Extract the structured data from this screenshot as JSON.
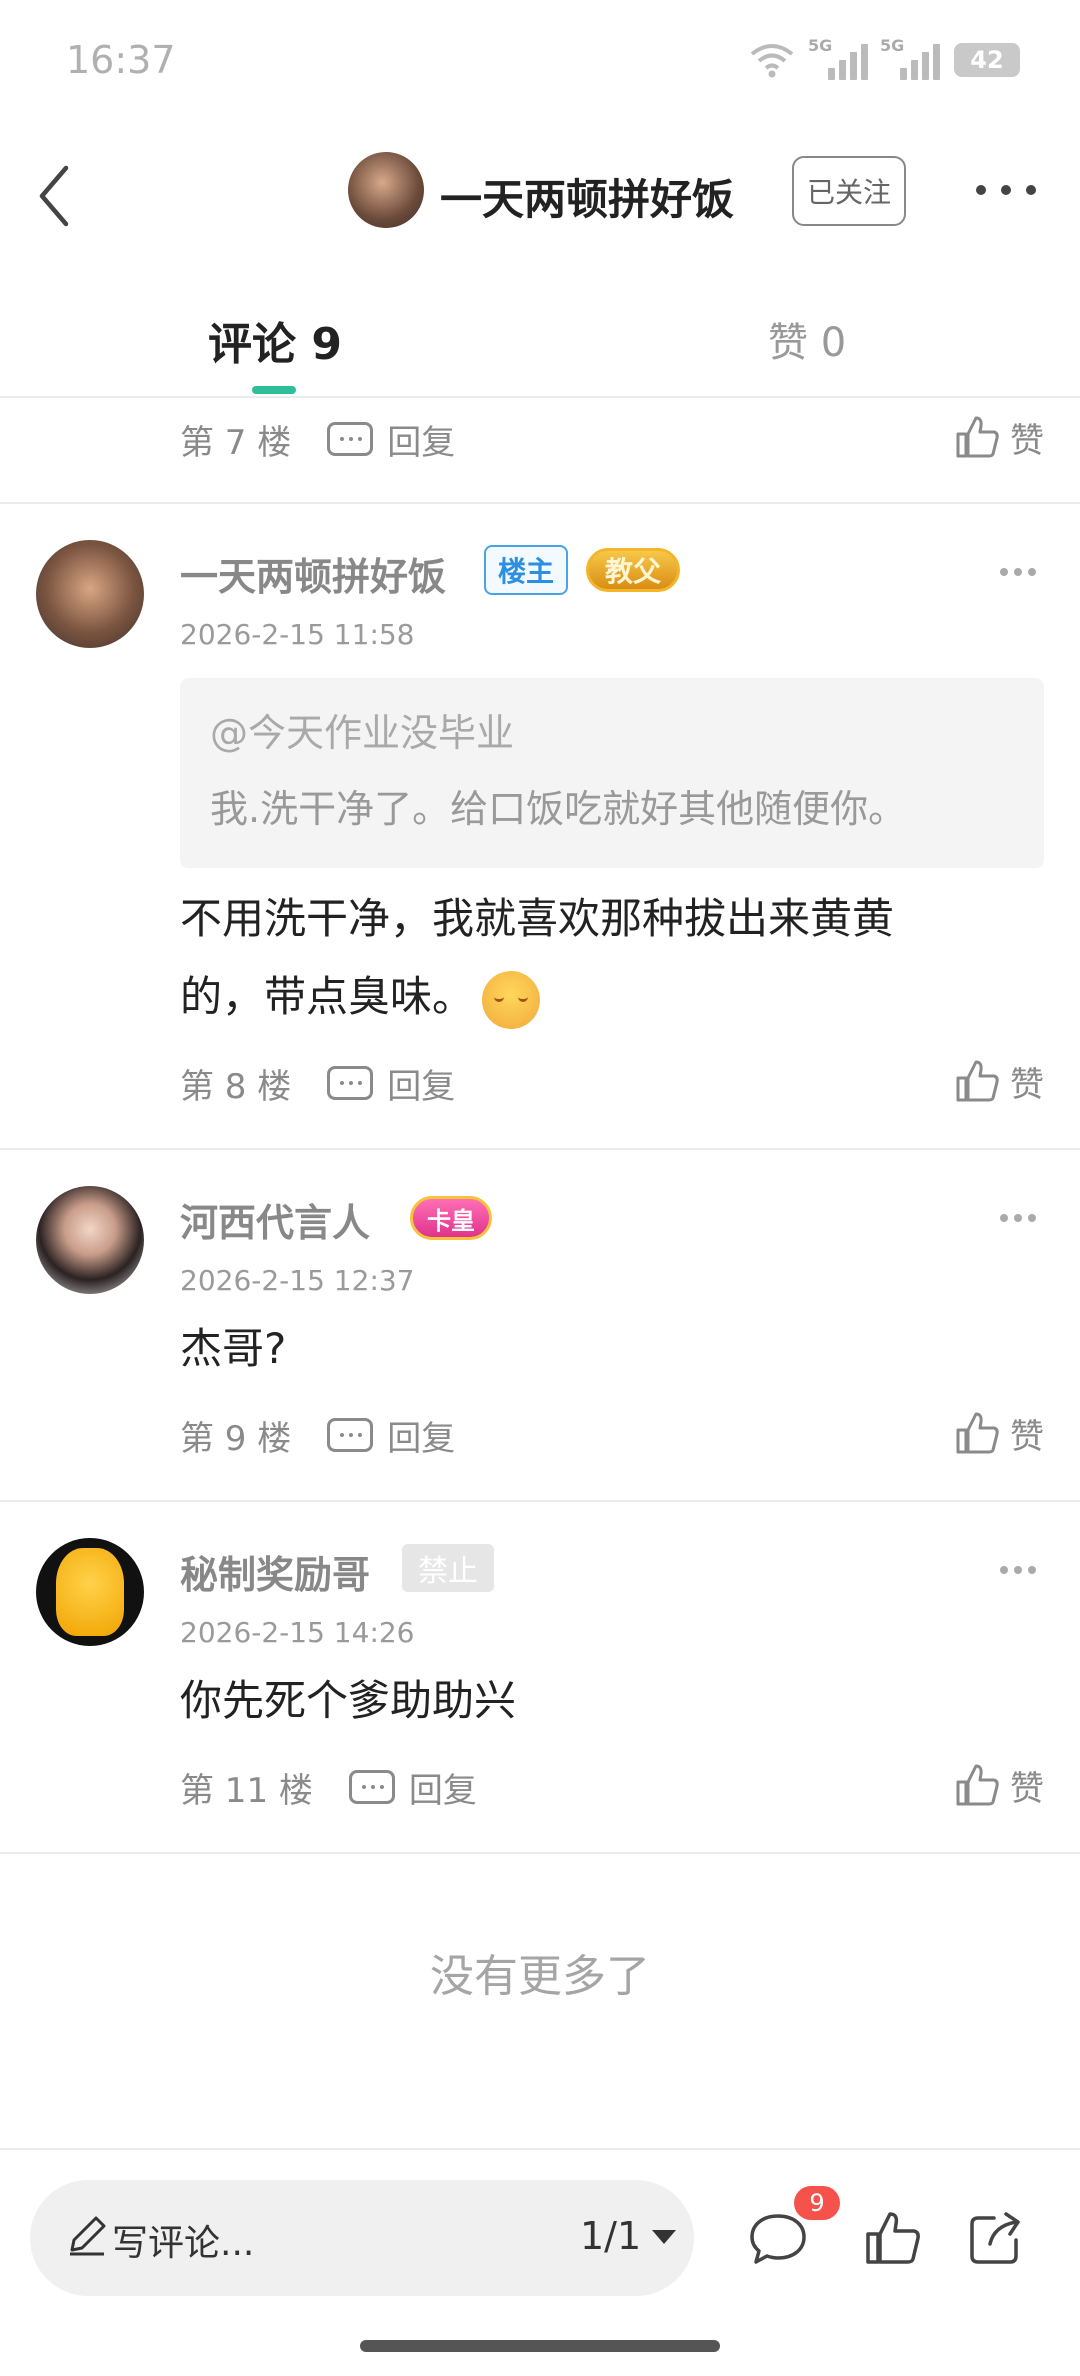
{
  "status_bar": {
    "time": "16:37",
    "network_1": "5G",
    "network_2": "5G",
    "battery": "42"
  },
  "header": {
    "title": "一天两顿拼好饭",
    "follow_label": "已关注"
  },
  "tabs": {
    "comments_label": "评论 9",
    "likes_label": "赞 0"
  },
  "floor7": {
    "floor": "第 7 楼",
    "reply_label": "回复",
    "like_label": "赞"
  },
  "comments": [
    {
      "username": "一天两顿拼好饭",
      "owner_badge": "楼主",
      "title_badge": "教父",
      "timestamp": "2026-2-15 11:58",
      "quote_user": "@今天作业没毕业",
      "quote_text": "我.洗干净了。给口饭吃就好其他随便你。",
      "content_line1": "不用洗干净，我就喜欢那种拔出来黄黄",
      "content_line2": "的，带点臭味。",
      "floor": "第 8 楼",
      "reply_label": "回复",
      "like_label": "赞"
    },
    {
      "username": "河西代言人",
      "title_badge": "卡皇",
      "timestamp": "2026-2-15 12:37",
      "content": "杰哥?",
      "floor": "第 9 楼",
      "reply_label": "回复",
      "like_label": "赞"
    },
    {
      "username": "秘制奖励哥",
      "status_badge": "禁止",
      "timestamp": "2026-2-15 14:26",
      "content": "你先死个爹助助兴",
      "floor": "第 11 楼",
      "reply_label": "回复",
      "like_label": "赞"
    }
  ],
  "end_text": "没有更多了",
  "bottom_bar": {
    "write_placeholder": "写评论...",
    "pager": "1/1",
    "comment_count": "9"
  },
  "icons": {
    "back": "back-arrow-icon",
    "more": "more-dots-icon",
    "reply": "reply-icon",
    "like": "thumbs-up-icon",
    "pencil": "pencil-icon",
    "comment": "comment-bubble-icon",
    "share": "share-icon"
  },
  "colors": {
    "accent": "#2cbf9a",
    "owner_badge": "#2d8fe0",
    "notify_badge": "#f5524c"
  }
}
